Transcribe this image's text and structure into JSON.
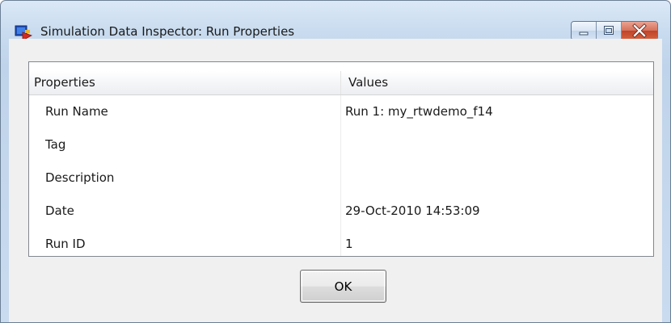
{
  "window": {
    "title": "Simulation Data Inspector: Run Properties",
    "icon": "simulink-model-icon",
    "controls": {
      "minimize": "minimize-icon",
      "maximize": "maximize-icon",
      "close": "close-icon"
    }
  },
  "table": {
    "headers": {
      "properties": "Properties",
      "values": "Values"
    },
    "rows": [
      {
        "property": "Run Name",
        "value": "Run 1: my_rtwdemo_f14"
      },
      {
        "property": "Tag",
        "value": ""
      },
      {
        "property": "Description",
        "value": ""
      },
      {
        "property": "Date",
        "value": "29-Oct-2010 14:53:09"
      },
      {
        "property": "Run ID",
        "value": "1"
      }
    ]
  },
  "buttons": {
    "ok_label": "OK"
  },
  "colors": {
    "title_bar": "#c8dbef",
    "close_button": "#c8462c",
    "dialog_background": "#f0f0f0",
    "table_border": "#828790"
  }
}
